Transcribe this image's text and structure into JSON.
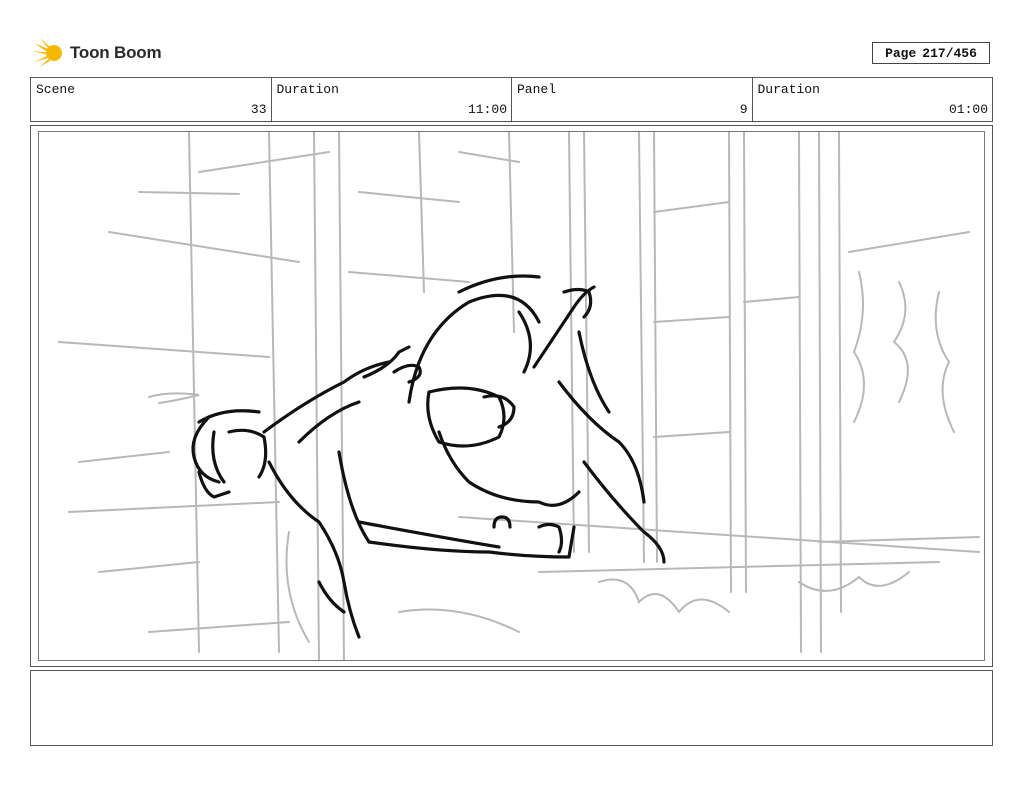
{
  "brand": {
    "name": "Toon Boom",
    "accent": "#f5b800",
    "text_color": "#2a2a2a"
  },
  "page": {
    "label": "Page",
    "value": "217/456"
  },
  "info": {
    "scene_label": "Scene",
    "scene_value": "33",
    "duration_label": "Duration",
    "duration_value": "11:00",
    "panel_label": "Panel",
    "panel_value": "9",
    "panel_duration_label": "Duration",
    "panel_duration_value": "01:00"
  },
  "panel_image": {
    "subject": "storyboard-sketch",
    "stroke_dark": "#111111",
    "stroke_light": "#b8b8b8"
  },
  "notes": {
    "text": ""
  }
}
